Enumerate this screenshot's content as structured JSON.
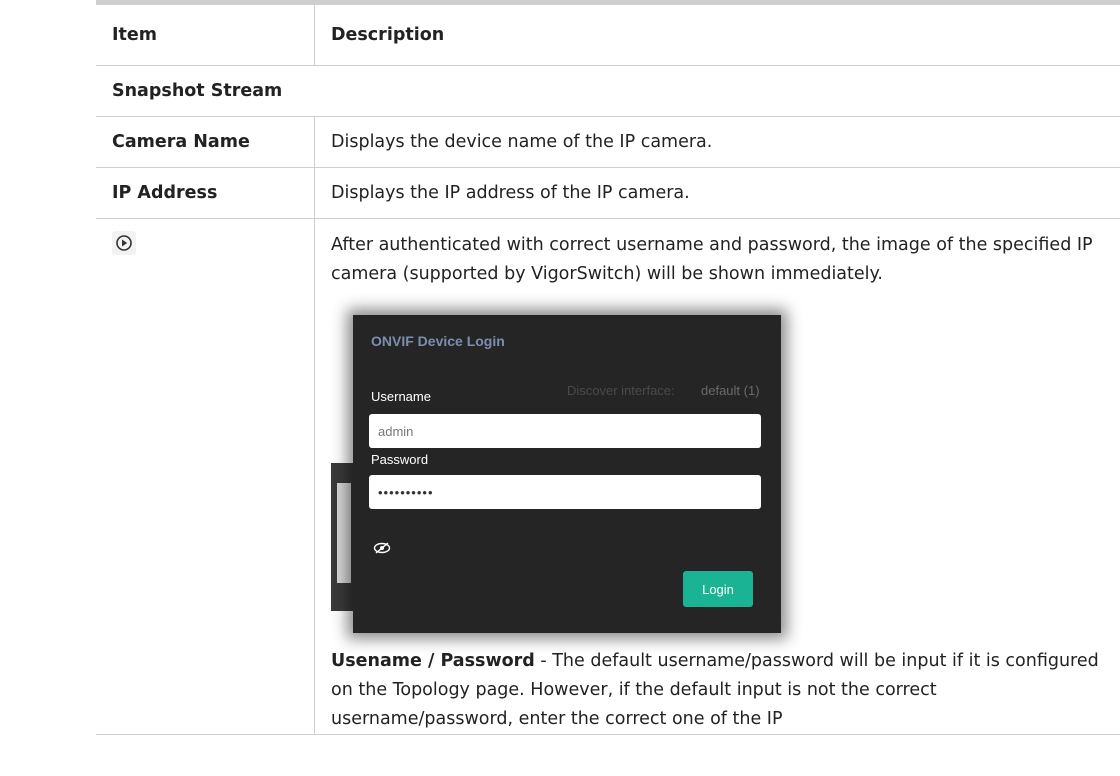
{
  "table": {
    "header_item": "Item",
    "header_description": "Description",
    "section_title": "Snapshot Stream",
    "rows": [
      {
        "item": "Camera Name",
        "description": "Displays the device name of the IP camera."
      },
      {
        "item": "IP Address",
        "description": "Displays the IP address of the IP camera."
      }
    ],
    "play_row": {
      "icon": "play-circle-icon",
      "description": "After authenticated with correct username and password, the image of the specified IP camera (supported by VigorSwitch) will be shown immediately.",
      "note_bold": "Usename / Password",
      "note_text": " - The default username/password will be input if it is configured on the Topology page. However, if the default input is not the correct username/password, enter the correct one of the IP"
    }
  },
  "dialog": {
    "title": "ONVIF Device Login",
    "background_label": "Discover interface:",
    "background_value": "default (1)",
    "username_label": "Username",
    "username_value": "admin",
    "password_label": "Password",
    "password_value": "••••••••••",
    "eye_icon": "eye-slash-icon",
    "login_button": "Login",
    "colors": {
      "accent": "#1ab394",
      "title": "#7c8db0",
      "background": "#252525"
    }
  }
}
